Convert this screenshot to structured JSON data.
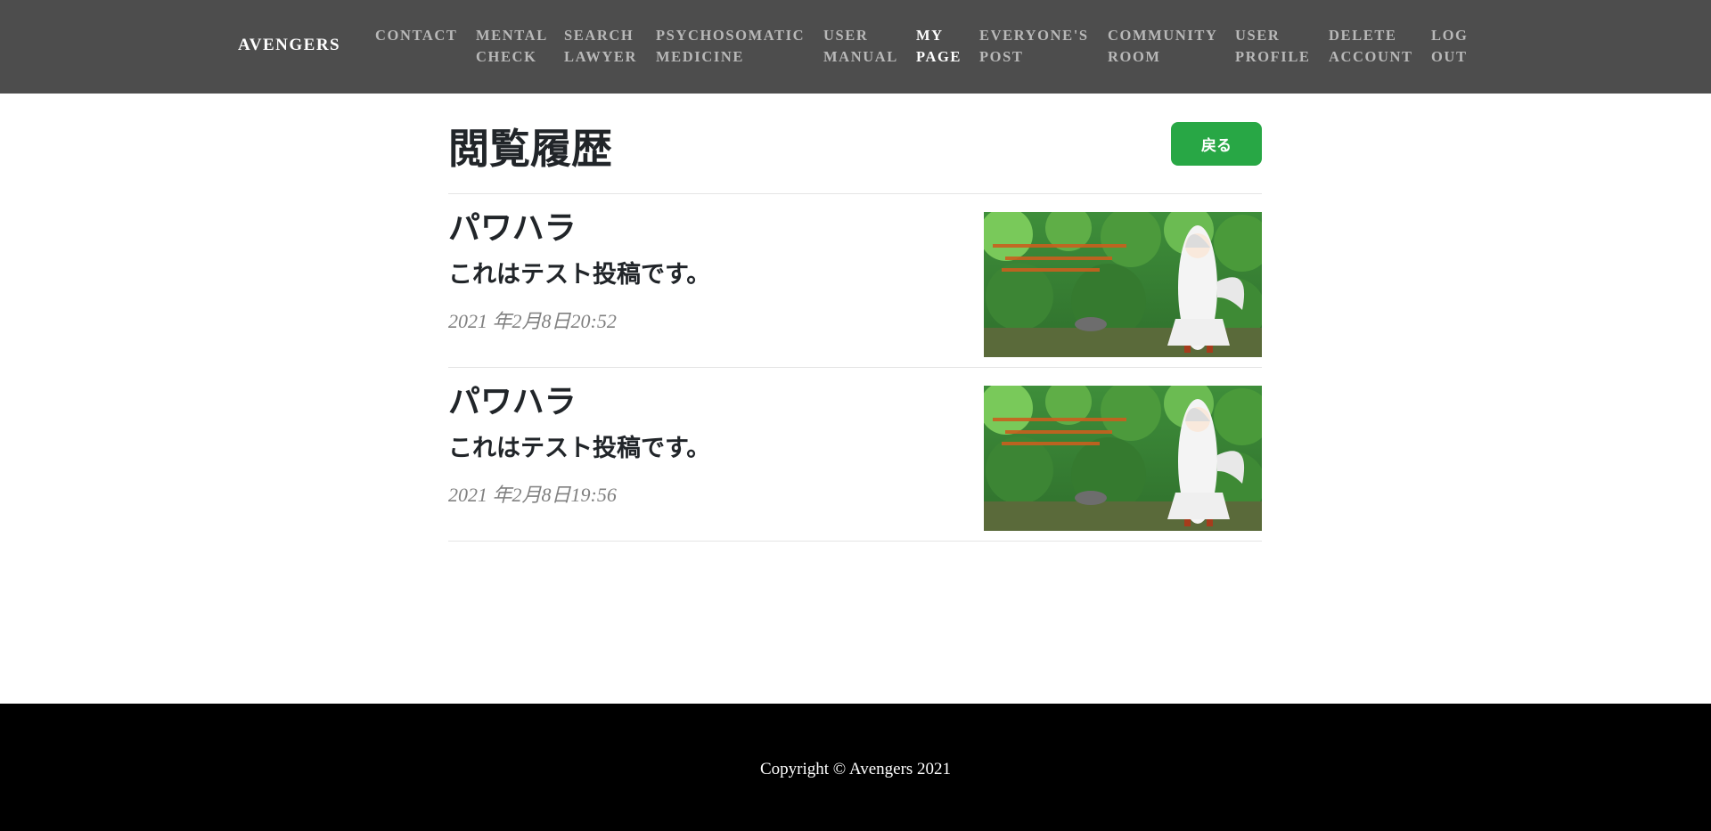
{
  "navbar": {
    "brand": "AVENGERS",
    "items": [
      {
        "label": "CONTACT",
        "active": false
      },
      {
        "label": "MENTAL\nCHECK",
        "active": false
      },
      {
        "label": "SEARCH\nLAWYER",
        "active": false
      },
      {
        "label": "PSYCHOSOMATIC\nMEDICINE",
        "active": false
      },
      {
        "label": "USER\nMANUAL",
        "active": false
      },
      {
        "label": "MY\nPAGE",
        "active": true
      },
      {
        "label": "EVERYONE'S\nPOST",
        "active": false
      },
      {
        "label": "COMMUNITY\nROOM",
        "active": false
      },
      {
        "label": "USER\nPROFILE",
        "active": false
      },
      {
        "label": "DELETE\nACCOUNT",
        "active": false
      },
      {
        "label": "LOG\nOUT",
        "active": false
      }
    ]
  },
  "main": {
    "title": "閲覧履歴",
    "back_label": "戻る",
    "posts": [
      {
        "title": "パワハラ",
        "body": "これはテスト投稿です。",
        "date": "2021 年2月8日20:52"
      },
      {
        "title": "パワハラ",
        "body": "これはテスト投稿です。",
        "date": "2021 年2月8日19:56"
      }
    ]
  },
  "footer": {
    "copyright": "Copyright © Avengers 2021"
  },
  "colors": {
    "navbar_bg": "#4d4d4d",
    "accent_green": "#28a745",
    "footer_bg": "#000000"
  }
}
